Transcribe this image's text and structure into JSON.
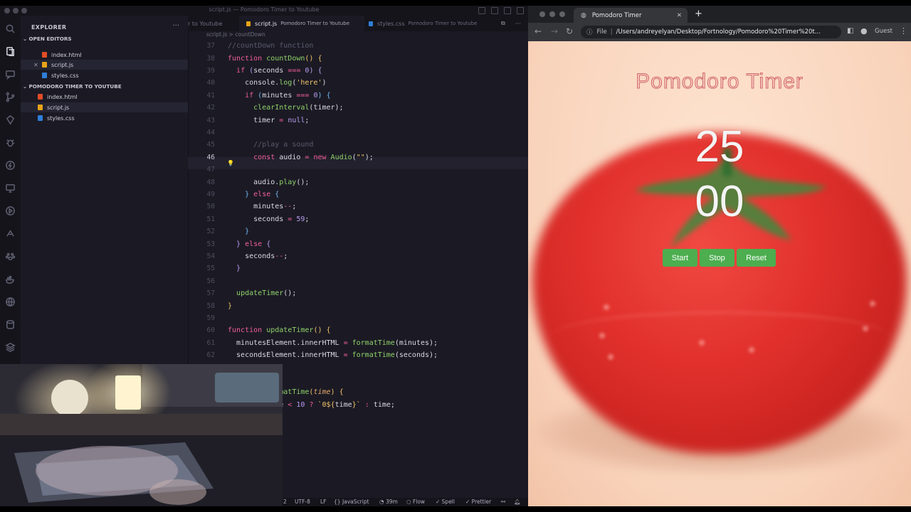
{
  "vscode": {
    "window_title": "script.js — Pomodoro Timer to Youtube",
    "sidebar": {
      "header": "EXPLORER",
      "more": "···",
      "open_editors_title": "OPEN EDITORS",
      "open_editors": [
        {
          "name": "index.html",
          "type": "html"
        },
        {
          "name": "script.js",
          "type": "js"
        },
        {
          "name": "styles.css",
          "type": "css"
        }
      ],
      "project_title": "POMODORO TIMER TO YOUTUBE",
      "project_files": [
        {
          "name": "index.html",
          "type": "html"
        },
        {
          "name": "script.js",
          "type": "js"
        },
        {
          "name": "styles.css",
          "type": "css"
        }
      ]
    },
    "tabs": [
      {
        "label": "r to Youtube",
        "sub": ""
      },
      {
        "label": "script.js",
        "sub": "Pomodoro Timer to Youtube"
      },
      {
        "label": "styles.css",
        "sub": "Pomodoro Timer to Youtube"
      }
    ],
    "breadcrumb": {
      "file": "script.js",
      "sep": ">",
      "symbol": "countDown"
    },
    "current_line": 46,
    "status": {
      "line_col": "2",
      "encoding": "UTF-8",
      "eol": "LF",
      "language": "JavaScript",
      "time": "39m",
      "flow": "Flow",
      "spell": "Spell",
      "prettier": "Prettier"
    }
  },
  "browser": {
    "tab_title": "Pomodoro Timer",
    "url_scheme": "File",
    "url": "/Users/andreyelyan/Desktop/Fortnology/Pomodoro%20Timer%20t...",
    "profile": "Guest",
    "page": {
      "title": "Pomodoro Timer",
      "minutes": "25",
      "seconds": "00",
      "buttons": {
        "start": "Start",
        "stop": "Stop",
        "reset": "Reset"
      }
    }
  },
  "colors": {
    "editor_bg": "#1b1a24",
    "button_green": "#4cae4f",
    "tomato_red": "#e2312d",
    "page_bg": "#fbd9c2"
  }
}
